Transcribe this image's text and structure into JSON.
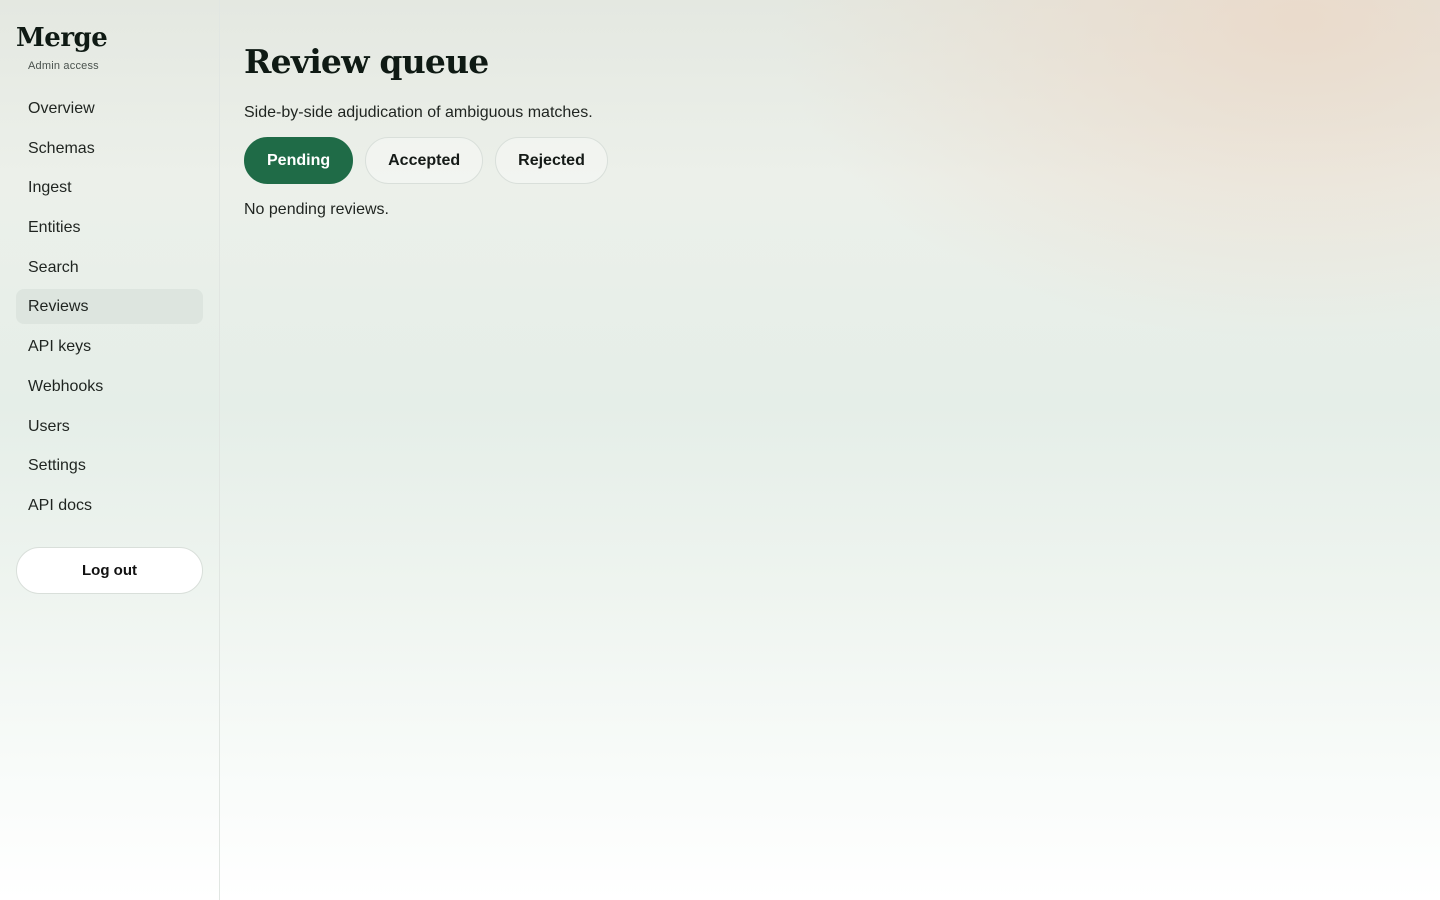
{
  "brand": {
    "name": "Merge",
    "subtitle": "Admin access"
  },
  "sidebar": {
    "items": [
      {
        "label": "Overview"
      },
      {
        "label": "Schemas"
      },
      {
        "label": "Ingest"
      },
      {
        "label": "Entities"
      },
      {
        "label": "Search"
      },
      {
        "label": "Reviews",
        "active": true
      },
      {
        "label": "API keys"
      },
      {
        "label": "Webhooks"
      },
      {
        "label": "Users"
      },
      {
        "label": "Settings"
      },
      {
        "label": "API docs"
      }
    ],
    "logout_label": "Log out"
  },
  "main": {
    "title": "Review queue",
    "subtitle": "Side-by-side adjudication of ambiguous matches.",
    "tabs": [
      {
        "label": "Pending",
        "active": true
      },
      {
        "label": "Accepted"
      },
      {
        "label": "Rejected"
      }
    ],
    "empty_message": "No pending reviews."
  },
  "colors": {
    "accent": "#1f6b47",
    "active_nav_bg": "#dde5df",
    "text": "#1f2420"
  }
}
